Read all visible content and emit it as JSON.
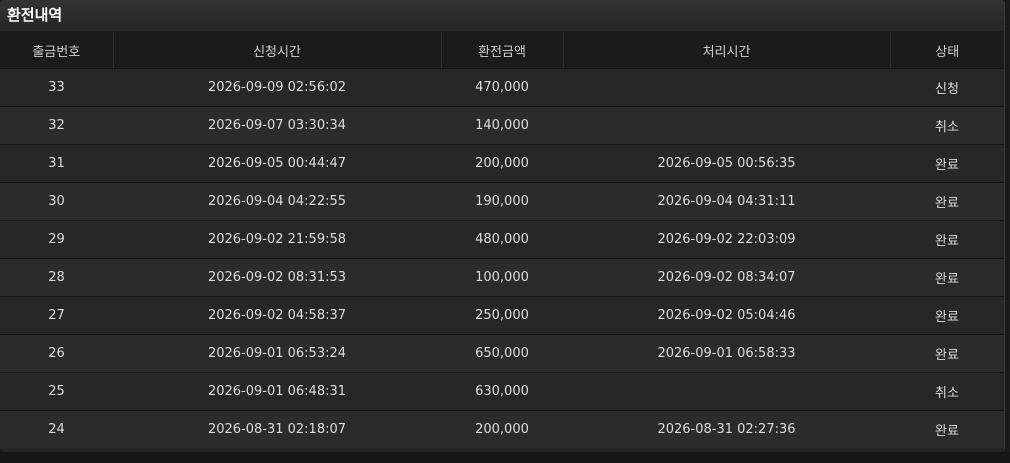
{
  "panel": {
    "title": "환전내역"
  },
  "table": {
    "headers": [
      "출금번호",
      "신청시간",
      "환전금액",
      "처리시간",
      "상태"
    ],
    "rows": [
      {
        "id": "33",
        "requested": "2026-09-09 02:56:02",
        "amount": "470,000",
        "processed": "",
        "status": "신청"
      },
      {
        "id": "32",
        "requested": "2026-09-07 03:30:34",
        "amount": "140,000",
        "processed": "",
        "status": "취소"
      },
      {
        "id": "31",
        "requested": "2026-09-05 00:44:47",
        "amount": "200,000",
        "processed": "2026-09-05 00:56:35",
        "status": "완료"
      },
      {
        "id": "30",
        "requested": "2026-09-04 04:22:55",
        "amount": "190,000",
        "processed": "2026-09-04 04:31:11",
        "status": "완료"
      },
      {
        "id": "29",
        "requested": "2026-09-02 21:59:58",
        "amount": "480,000",
        "processed": "2026-09-02 22:03:09",
        "status": "완료"
      },
      {
        "id": "28",
        "requested": "2026-09-02 08:31:53",
        "amount": "100,000",
        "processed": "2026-09-02 08:34:07",
        "status": "완료"
      },
      {
        "id": "27",
        "requested": "2026-09-02 04:58:37",
        "amount": "250,000",
        "processed": "2026-09-02 05:04:46",
        "status": "완료"
      },
      {
        "id": "26",
        "requested": "2026-09-01 06:53:24",
        "amount": "650,000",
        "processed": "2026-09-01 06:58:33",
        "status": "완료"
      },
      {
        "id": "25",
        "requested": "2026-09-01 06:48:31",
        "amount": "630,000",
        "processed": "",
        "status": "취소"
      },
      {
        "id": "24",
        "requested": "2026-08-31 02:18:07",
        "amount": "200,000",
        "processed": "2026-08-31 02:27:36",
        "status": "완료"
      }
    ]
  }
}
